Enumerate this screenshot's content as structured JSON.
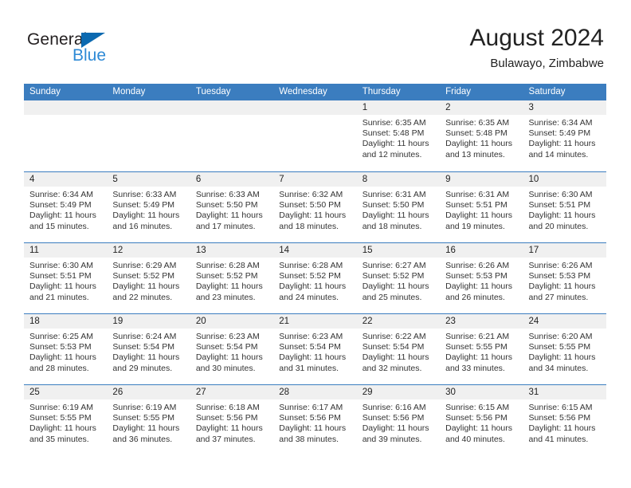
{
  "logo": {
    "word_top": "General",
    "word_bottom": "Blue",
    "triangle_color": "#0b69b0",
    "blue_text_color": "#2e8ad6"
  },
  "header": {
    "month_title": "August 2024",
    "location": "Bulawayo, Zimbabwe"
  },
  "theme": {
    "header_blue": "#3b7dbf",
    "day_band_gray": "#f0f0f0"
  },
  "calendar": {
    "weekday_headers": [
      "Sunday",
      "Monday",
      "Tuesday",
      "Wednesday",
      "Thursday",
      "Friday",
      "Saturday"
    ],
    "weeks": [
      [
        {
          "empty": true
        },
        {
          "empty": true
        },
        {
          "empty": true
        },
        {
          "empty": true
        },
        {
          "day": "1",
          "sunrise": "Sunrise: 6:35 AM",
          "sunset": "Sunset: 5:48 PM",
          "daylight_1": "Daylight: 11 hours",
          "daylight_2": "and 12 minutes."
        },
        {
          "day": "2",
          "sunrise": "Sunrise: 6:35 AM",
          "sunset": "Sunset: 5:48 PM",
          "daylight_1": "Daylight: 11 hours",
          "daylight_2": "and 13 minutes."
        },
        {
          "day": "3",
          "sunrise": "Sunrise: 6:34 AM",
          "sunset": "Sunset: 5:49 PM",
          "daylight_1": "Daylight: 11 hours",
          "daylight_2": "and 14 minutes."
        }
      ],
      [
        {
          "day": "4",
          "sunrise": "Sunrise: 6:34 AM",
          "sunset": "Sunset: 5:49 PM",
          "daylight_1": "Daylight: 11 hours",
          "daylight_2": "and 15 minutes."
        },
        {
          "day": "5",
          "sunrise": "Sunrise: 6:33 AM",
          "sunset": "Sunset: 5:49 PM",
          "daylight_1": "Daylight: 11 hours",
          "daylight_2": "and 16 minutes."
        },
        {
          "day": "6",
          "sunrise": "Sunrise: 6:33 AM",
          "sunset": "Sunset: 5:50 PM",
          "daylight_1": "Daylight: 11 hours",
          "daylight_2": "and 17 minutes."
        },
        {
          "day": "7",
          "sunrise": "Sunrise: 6:32 AM",
          "sunset": "Sunset: 5:50 PM",
          "daylight_1": "Daylight: 11 hours",
          "daylight_2": "and 18 minutes."
        },
        {
          "day": "8",
          "sunrise": "Sunrise: 6:31 AM",
          "sunset": "Sunset: 5:50 PM",
          "daylight_1": "Daylight: 11 hours",
          "daylight_2": "and 18 minutes."
        },
        {
          "day": "9",
          "sunrise": "Sunrise: 6:31 AM",
          "sunset": "Sunset: 5:51 PM",
          "daylight_1": "Daylight: 11 hours",
          "daylight_2": "and 19 minutes."
        },
        {
          "day": "10",
          "sunrise": "Sunrise: 6:30 AM",
          "sunset": "Sunset: 5:51 PM",
          "daylight_1": "Daylight: 11 hours",
          "daylight_2": "and 20 minutes."
        }
      ],
      [
        {
          "day": "11",
          "sunrise": "Sunrise: 6:30 AM",
          "sunset": "Sunset: 5:51 PM",
          "daylight_1": "Daylight: 11 hours",
          "daylight_2": "and 21 minutes."
        },
        {
          "day": "12",
          "sunrise": "Sunrise: 6:29 AM",
          "sunset": "Sunset: 5:52 PM",
          "daylight_1": "Daylight: 11 hours",
          "daylight_2": "and 22 minutes."
        },
        {
          "day": "13",
          "sunrise": "Sunrise: 6:28 AM",
          "sunset": "Sunset: 5:52 PM",
          "daylight_1": "Daylight: 11 hours",
          "daylight_2": "and 23 minutes."
        },
        {
          "day": "14",
          "sunrise": "Sunrise: 6:28 AM",
          "sunset": "Sunset: 5:52 PM",
          "daylight_1": "Daylight: 11 hours",
          "daylight_2": "and 24 minutes."
        },
        {
          "day": "15",
          "sunrise": "Sunrise: 6:27 AM",
          "sunset": "Sunset: 5:52 PM",
          "daylight_1": "Daylight: 11 hours",
          "daylight_2": "and 25 minutes."
        },
        {
          "day": "16",
          "sunrise": "Sunrise: 6:26 AM",
          "sunset": "Sunset: 5:53 PM",
          "daylight_1": "Daylight: 11 hours",
          "daylight_2": "and 26 minutes."
        },
        {
          "day": "17",
          "sunrise": "Sunrise: 6:26 AM",
          "sunset": "Sunset: 5:53 PM",
          "daylight_1": "Daylight: 11 hours",
          "daylight_2": "and 27 minutes."
        }
      ],
      [
        {
          "day": "18",
          "sunrise": "Sunrise: 6:25 AM",
          "sunset": "Sunset: 5:53 PM",
          "daylight_1": "Daylight: 11 hours",
          "daylight_2": "and 28 minutes."
        },
        {
          "day": "19",
          "sunrise": "Sunrise: 6:24 AM",
          "sunset": "Sunset: 5:54 PM",
          "daylight_1": "Daylight: 11 hours",
          "daylight_2": "and 29 minutes."
        },
        {
          "day": "20",
          "sunrise": "Sunrise: 6:23 AM",
          "sunset": "Sunset: 5:54 PM",
          "daylight_1": "Daylight: 11 hours",
          "daylight_2": "and 30 minutes."
        },
        {
          "day": "21",
          "sunrise": "Sunrise: 6:23 AM",
          "sunset": "Sunset: 5:54 PM",
          "daylight_1": "Daylight: 11 hours",
          "daylight_2": "and 31 minutes."
        },
        {
          "day": "22",
          "sunrise": "Sunrise: 6:22 AM",
          "sunset": "Sunset: 5:54 PM",
          "daylight_1": "Daylight: 11 hours",
          "daylight_2": "and 32 minutes."
        },
        {
          "day": "23",
          "sunrise": "Sunrise: 6:21 AM",
          "sunset": "Sunset: 5:55 PM",
          "daylight_1": "Daylight: 11 hours",
          "daylight_2": "and 33 minutes."
        },
        {
          "day": "24",
          "sunrise": "Sunrise: 6:20 AM",
          "sunset": "Sunset: 5:55 PM",
          "daylight_1": "Daylight: 11 hours",
          "daylight_2": "and 34 minutes."
        }
      ],
      [
        {
          "day": "25",
          "sunrise": "Sunrise: 6:19 AM",
          "sunset": "Sunset: 5:55 PM",
          "daylight_1": "Daylight: 11 hours",
          "daylight_2": "and 35 minutes."
        },
        {
          "day": "26",
          "sunrise": "Sunrise: 6:19 AM",
          "sunset": "Sunset: 5:55 PM",
          "daylight_1": "Daylight: 11 hours",
          "daylight_2": "and 36 minutes."
        },
        {
          "day": "27",
          "sunrise": "Sunrise: 6:18 AM",
          "sunset": "Sunset: 5:56 PM",
          "daylight_1": "Daylight: 11 hours",
          "daylight_2": "and 37 minutes."
        },
        {
          "day": "28",
          "sunrise": "Sunrise: 6:17 AM",
          "sunset": "Sunset: 5:56 PM",
          "daylight_1": "Daylight: 11 hours",
          "daylight_2": "and 38 minutes."
        },
        {
          "day": "29",
          "sunrise": "Sunrise: 6:16 AM",
          "sunset": "Sunset: 5:56 PM",
          "daylight_1": "Daylight: 11 hours",
          "daylight_2": "and 39 minutes."
        },
        {
          "day": "30",
          "sunrise": "Sunrise: 6:15 AM",
          "sunset": "Sunset: 5:56 PM",
          "daylight_1": "Daylight: 11 hours",
          "daylight_2": "and 40 minutes."
        },
        {
          "day": "31",
          "sunrise": "Sunrise: 6:15 AM",
          "sunset": "Sunset: 5:56 PM",
          "daylight_1": "Daylight: 11 hours",
          "daylight_2": "and 41 minutes."
        }
      ]
    ]
  }
}
